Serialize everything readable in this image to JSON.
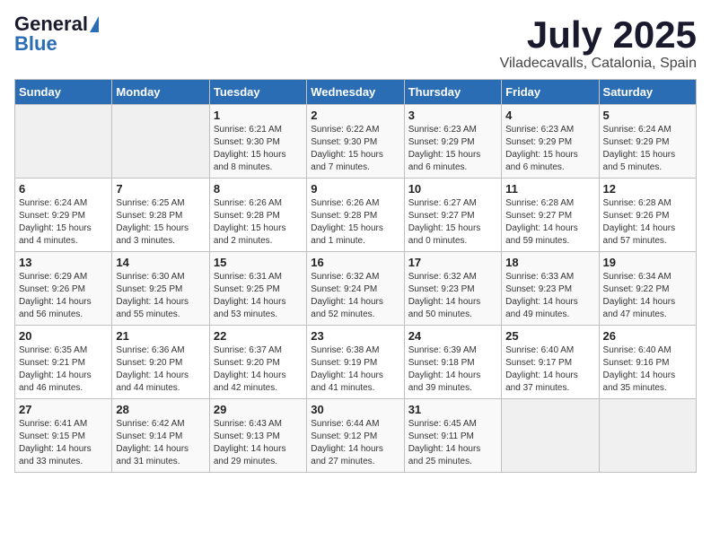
{
  "logo": {
    "general": "General",
    "blue": "Blue"
  },
  "title": {
    "month_year": "July 2025",
    "location": "Viladecavalls, Catalonia, Spain"
  },
  "days_of_week": [
    "Sunday",
    "Monday",
    "Tuesday",
    "Wednesday",
    "Thursday",
    "Friday",
    "Saturday"
  ],
  "weeks": [
    [
      {
        "day": "",
        "empty": true
      },
      {
        "day": "",
        "empty": true
      },
      {
        "day": "1",
        "sunrise": "Sunrise: 6:21 AM",
        "sunset": "Sunset: 9:30 PM",
        "daylight": "Daylight: 15 hours and 8 minutes."
      },
      {
        "day": "2",
        "sunrise": "Sunrise: 6:22 AM",
        "sunset": "Sunset: 9:30 PM",
        "daylight": "Daylight: 15 hours and 7 minutes."
      },
      {
        "day": "3",
        "sunrise": "Sunrise: 6:23 AM",
        "sunset": "Sunset: 9:29 PM",
        "daylight": "Daylight: 15 hours and 6 minutes."
      },
      {
        "day": "4",
        "sunrise": "Sunrise: 6:23 AM",
        "sunset": "Sunset: 9:29 PM",
        "daylight": "Daylight: 15 hours and 6 minutes."
      },
      {
        "day": "5",
        "sunrise": "Sunrise: 6:24 AM",
        "sunset": "Sunset: 9:29 PM",
        "daylight": "Daylight: 15 hours and 5 minutes."
      }
    ],
    [
      {
        "day": "6",
        "sunrise": "Sunrise: 6:24 AM",
        "sunset": "Sunset: 9:29 PM",
        "daylight": "Daylight: 15 hours and 4 minutes."
      },
      {
        "day": "7",
        "sunrise": "Sunrise: 6:25 AM",
        "sunset": "Sunset: 9:28 PM",
        "daylight": "Daylight: 15 hours and 3 minutes."
      },
      {
        "day": "8",
        "sunrise": "Sunrise: 6:26 AM",
        "sunset": "Sunset: 9:28 PM",
        "daylight": "Daylight: 15 hours and 2 minutes."
      },
      {
        "day": "9",
        "sunrise": "Sunrise: 6:26 AM",
        "sunset": "Sunset: 9:28 PM",
        "daylight": "Daylight: 15 hours and 1 minute."
      },
      {
        "day": "10",
        "sunrise": "Sunrise: 6:27 AM",
        "sunset": "Sunset: 9:27 PM",
        "daylight": "Daylight: 15 hours and 0 minutes."
      },
      {
        "day": "11",
        "sunrise": "Sunrise: 6:28 AM",
        "sunset": "Sunset: 9:27 PM",
        "daylight": "Daylight: 14 hours and 59 minutes."
      },
      {
        "day": "12",
        "sunrise": "Sunrise: 6:28 AM",
        "sunset": "Sunset: 9:26 PM",
        "daylight": "Daylight: 14 hours and 57 minutes."
      }
    ],
    [
      {
        "day": "13",
        "sunrise": "Sunrise: 6:29 AM",
        "sunset": "Sunset: 9:26 PM",
        "daylight": "Daylight: 14 hours and 56 minutes."
      },
      {
        "day": "14",
        "sunrise": "Sunrise: 6:30 AM",
        "sunset": "Sunset: 9:25 PM",
        "daylight": "Daylight: 14 hours and 55 minutes."
      },
      {
        "day": "15",
        "sunrise": "Sunrise: 6:31 AM",
        "sunset": "Sunset: 9:25 PM",
        "daylight": "Daylight: 14 hours and 53 minutes."
      },
      {
        "day": "16",
        "sunrise": "Sunrise: 6:32 AM",
        "sunset": "Sunset: 9:24 PM",
        "daylight": "Daylight: 14 hours and 52 minutes."
      },
      {
        "day": "17",
        "sunrise": "Sunrise: 6:32 AM",
        "sunset": "Sunset: 9:23 PM",
        "daylight": "Daylight: 14 hours and 50 minutes."
      },
      {
        "day": "18",
        "sunrise": "Sunrise: 6:33 AM",
        "sunset": "Sunset: 9:23 PM",
        "daylight": "Daylight: 14 hours and 49 minutes."
      },
      {
        "day": "19",
        "sunrise": "Sunrise: 6:34 AM",
        "sunset": "Sunset: 9:22 PM",
        "daylight": "Daylight: 14 hours and 47 minutes."
      }
    ],
    [
      {
        "day": "20",
        "sunrise": "Sunrise: 6:35 AM",
        "sunset": "Sunset: 9:21 PM",
        "daylight": "Daylight: 14 hours and 46 minutes."
      },
      {
        "day": "21",
        "sunrise": "Sunrise: 6:36 AM",
        "sunset": "Sunset: 9:20 PM",
        "daylight": "Daylight: 14 hours and 44 minutes."
      },
      {
        "day": "22",
        "sunrise": "Sunrise: 6:37 AM",
        "sunset": "Sunset: 9:20 PM",
        "daylight": "Daylight: 14 hours and 42 minutes."
      },
      {
        "day": "23",
        "sunrise": "Sunrise: 6:38 AM",
        "sunset": "Sunset: 9:19 PM",
        "daylight": "Daylight: 14 hours and 41 minutes."
      },
      {
        "day": "24",
        "sunrise": "Sunrise: 6:39 AM",
        "sunset": "Sunset: 9:18 PM",
        "daylight": "Daylight: 14 hours and 39 minutes."
      },
      {
        "day": "25",
        "sunrise": "Sunrise: 6:40 AM",
        "sunset": "Sunset: 9:17 PM",
        "daylight": "Daylight: 14 hours and 37 minutes."
      },
      {
        "day": "26",
        "sunrise": "Sunrise: 6:40 AM",
        "sunset": "Sunset: 9:16 PM",
        "daylight": "Daylight: 14 hours and 35 minutes."
      }
    ],
    [
      {
        "day": "27",
        "sunrise": "Sunrise: 6:41 AM",
        "sunset": "Sunset: 9:15 PM",
        "daylight": "Daylight: 14 hours and 33 minutes."
      },
      {
        "day": "28",
        "sunrise": "Sunrise: 6:42 AM",
        "sunset": "Sunset: 9:14 PM",
        "daylight": "Daylight: 14 hours and 31 minutes."
      },
      {
        "day": "29",
        "sunrise": "Sunrise: 6:43 AM",
        "sunset": "Sunset: 9:13 PM",
        "daylight": "Daylight: 14 hours and 29 minutes."
      },
      {
        "day": "30",
        "sunrise": "Sunrise: 6:44 AM",
        "sunset": "Sunset: 9:12 PM",
        "daylight": "Daylight: 14 hours and 27 minutes."
      },
      {
        "day": "31",
        "sunrise": "Sunrise: 6:45 AM",
        "sunset": "Sunset: 9:11 PM",
        "daylight": "Daylight: 14 hours and 25 minutes."
      },
      {
        "day": "",
        "empty": true
      },
      {
        "day": "",
        "empty": true
      }
    ]
  ]
}
